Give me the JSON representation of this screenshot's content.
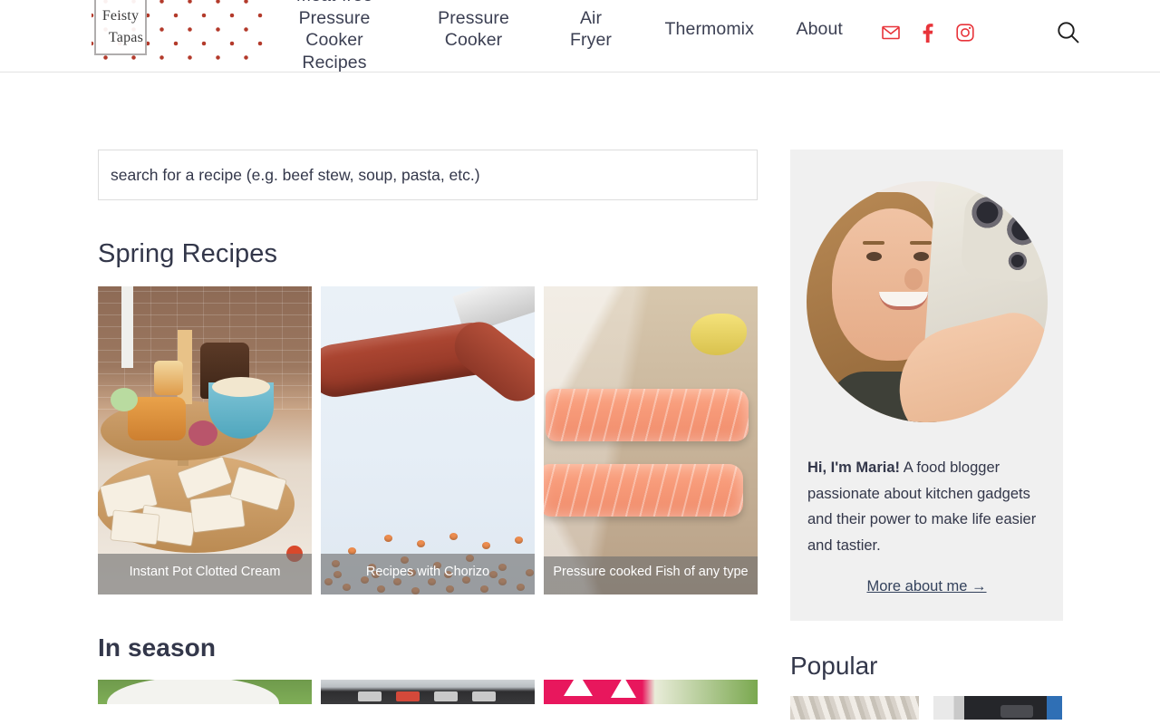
{
  "site": {
    "logo_line1": "Feisty",
    "logo_line2": "Tapas"
  },
  "nav": {
    "items": [
      {
        "label": "Meat-free\nPressure\nCooker\nRecipes",
        "name": "nav-meat-free-pressure-cooker-recipes"
      },
      {
        "label": "Pressure\nCooker",
        "name": "nav-pressure-cooker"
      },
      {
        "label": "Air\nFryer",
        "name": "nav-air-fryer"
      },
      {
        "label": "Thermomix",
        "name": "nav-thermomix"
      },
      {
        "label": "About",
        "name": "nav-about"
      }
    ],
    "social": [
      {
        "name": "email-icon",
        "glyph": "envelope"
      },
      {
        "name": "facebook-icon",
        "glyph": "facebook"
      },
      {
        "name": "instagram-icon",
        "glyph": "instagram"
      }
    ],
    "search_icon": "search-icon",
    "accent_color": "#e8343a"
  },
  "search": {
    "placeholder": "search for a recipe (e.g. beef stew, soup, pasta, etc.)",
    "value": ""
  },
  "main": {
    "spring_heading": "Spring Recipes",
    "spring_cards": [
      {
        "caption": "Instant Pot Clotted Cream",
        "photo": "afternoon-tea-stand"
      },
      {
        "caption": "Recipes with Chorizo",
        "photo": "chorizo-and-red-lentils"
      },
      {
        "caption": "Pressure cooked Fish of any type",
        "photo": "salmon-fillets-on-parchment"
      }
    ],
    "in_season_heading": "In season",
    "in_season_cards": [
      {
        "caption": "",
        "photo": "bowl-on-grass"
      },
      {
        "caption": "",
        "photo": "instant-pot-control-panel"
      },
      {
        "caption": "",
        "photo": "pink-dish-on-grass"
      }
    ]
  },
  "sidebar": {
    "avatar_alt": "Maria holding a phone",
    "bio_lead": "Hi, I'm Maria!",
    "bio_text": " A food blogger passionate about kitchen gadgets and their power to make life easier and tastier.",
    "bio_link": "More about me →",
    "popular_heading": "Popular",
    "popular_thumbs": [
      {
        "photo": "crinkled-foil"
      },
      {
        "photo": "instant-pot-appliance"
      }
    ],
    "box_color": "#f0f0f0"
  }
}
